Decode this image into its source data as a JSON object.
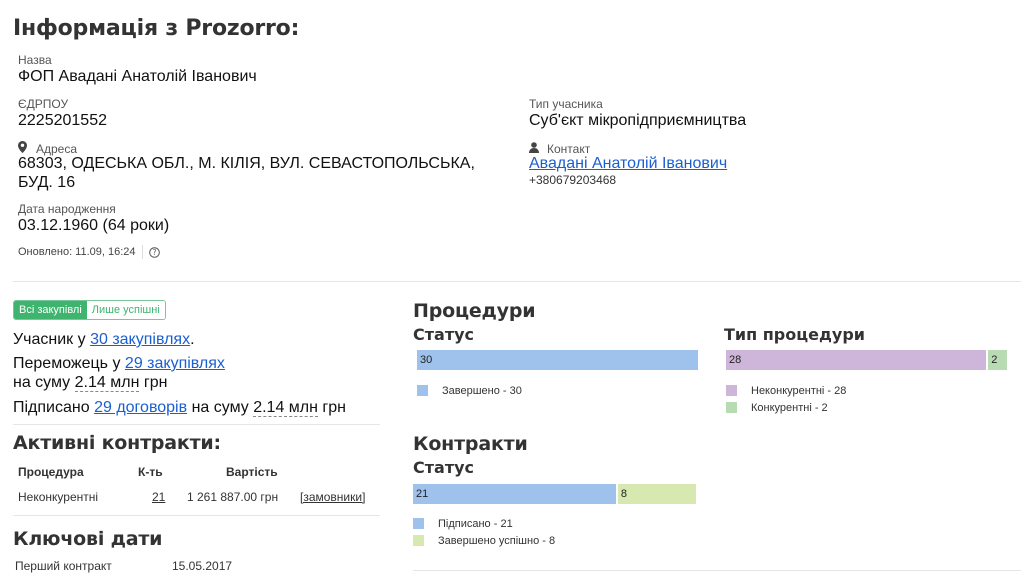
{
  "title": "Інформація з Prozorro:",
  "info": {
    "name_label": "Назва",
    "name_value": "ФОП Авадані Анатолій Іванович",
    "edrpou_label": "ЄДРПОУ",
    "edrpou_value": "2225201552",
    "type_label": "Тип учасника",
    "type_value": "Суб'єкт мікропідприємництва",
    "address_label": "Адреса",
    "address_line1": "68303, ОДЕСЬКА ОБЛ., М. КІЛІЯ, ВУЛ. СЕВАСТОПОЛЬСЬКА,",
    "address_line2": "БУД. 16",
    "contact_label": "Контакт",
    "contact_name": "Авадані Анатолій Іванович",
    "contact_phone": "+380679203468",
    "birth_label": "Дата народження",
    "birth_value": "03.12.1960 (64 роки)",
    "updated": "Оновлено: 11.09, 16:24",
    "help_icon": "question-circle-icon"
  },
  "filter": {
    "all": "Всі закупівлі",
    "success": "Лише успішні"
  },
  "summary": {
    "participant_prefix": "Учасник у",
    "participant_link": "30 закупівлях",
    "participant_suffix": ".",
    "winner_prefix": "Переможець у",
    "winner_link": "29 закупівлях",
    "winner_sum_prefix": "на суму",
    "winner_sum": "2.14 млн",
    "winner_sum_suffix": "грн",
    "signed_prefix": "Підписано",
    "signed_link": "29 договорів",
    "signed_sum_prefix": "на суму",
    "signed_sum": "2.14 млн",
    "signed_sum_suffix": "грн"
  },
  "active_contracts": {
    "title": "Активні контракти:",
    "headers": [
      "Процедура",
      "К-ть",
      "Вартість"
    ],
    "rows": [
      {
        "procedure": "Неконкурентні",
        "count": "21",
        "value": "1 261 887.00 грн",
        "customers": "[замовники]"
      }
    ]
  },
  "key_dates": {
    "title": "Ключові дати",
    "first_contract_label": "Перший контракт",
    "first_contract_value": "15.05.2017"
  },
  "procedures": {
    "title": "Процедури",
    "status_title": "Статус",
    "type_title": "Тип процедури",
    "status_bar": [
      {
        "label": "Завершено - 30",
        "value": 30,
        "color": "#9ec2ec"
      }
    ],
    "type_bar": [
      {
        "label": "Неконкурентні - 28",
        "value": 28,
        "color": "#cdb6d9"
      },
      {
        "label": "Конкурентні - 2",
        "value": 2,
        "color": "#b9dbb3"
      }
    ]
  },
  "contracts": {
    "title": "Контракти",
    "status_title": "Статус",
    "status_bar": [
      {
        "label": "Підписано - 21",
        "value": 21,
        "color": "#9ec2ec"
      },
      {
        "label": "Завершено успішно - 8",
        "value": 8,
        "color": "#d7e9b0"
      }
    ]
  }
}
